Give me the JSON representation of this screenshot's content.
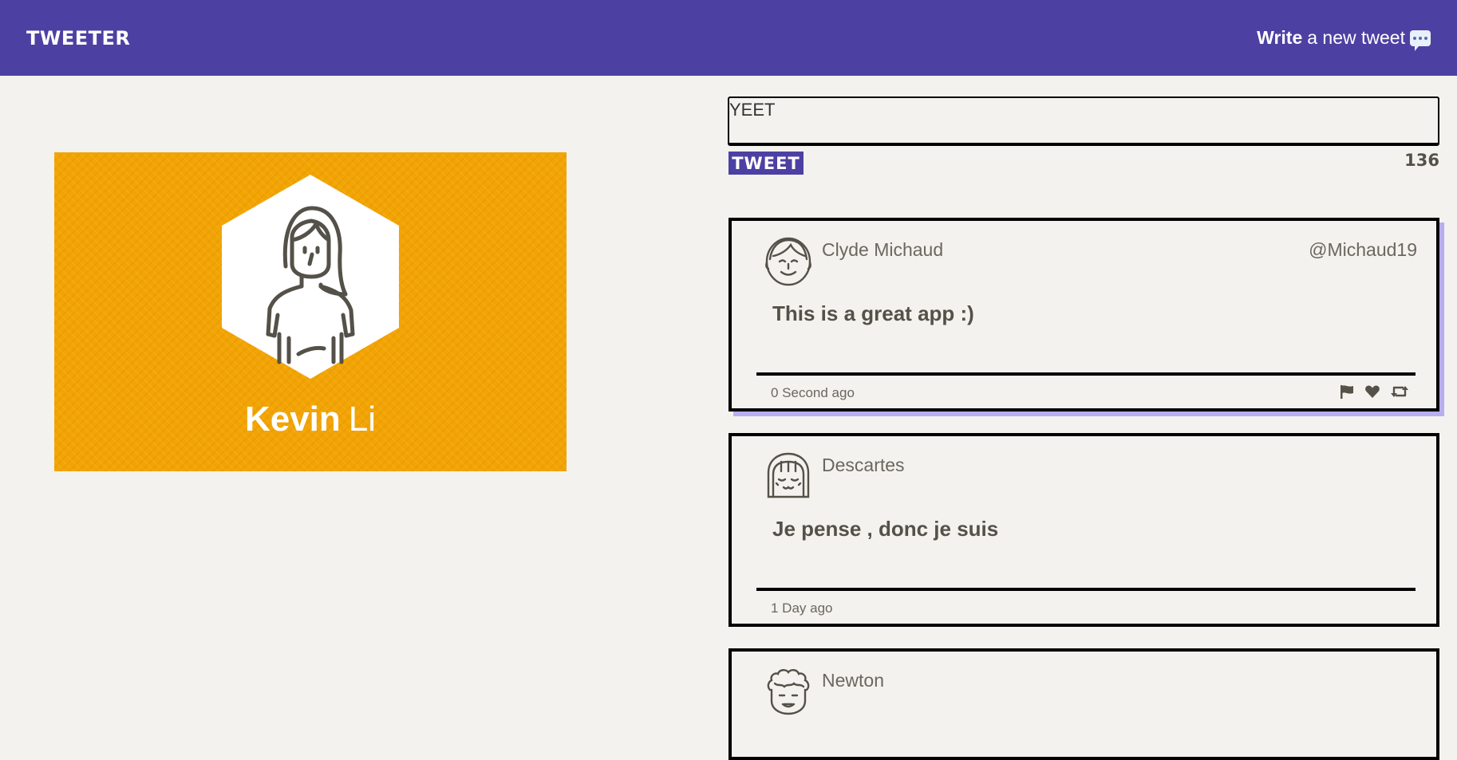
{
  "nav": {
    "logo": "TWEETER",
    "compose_bold": "Write",
    "compose_rest": "a new tweet",
    "compose_icon": "speech-bubble-icon"
  },
  "profile": {
    "first_name": "Kevin",
    "last_name": "Li",
    "background_color": "#f3a403",
    "avatar_icon": "woman-avatar-icon"
  },
  "composer": {
    "value": "YEET",
    "button_label": "TWEET",
    "remaining": "136"
  },
  "colors": {
    "primary": "#4c41a3",
    "background": "#f4f2ee",
    "highlight_shadow": "#b7aef0"
  },
  "tweets": [
    {
      "author": "Clyde Michaud",
      "handle": "@Michaud19",
      "content": "This is a great app :)",
      "time": "0 Second ago",
      "avatar_icon": "man-avatar-icon",
      "actions": [
        "flag-icon",
        "heart-icon",
        "retweet-icon"
      ]
    },
    {
      "author": "Descartes",
      "handle": "",
      "content": "Je pense , donc je suis",
      "time": "1 Day ago",
      "avatar_icon": "woman-bob-avatar-icon"
    },
    {
      "author": "Newton",
      "handle": "",
      "content": "",
      "time": "",
      "avatar_icon": "curly-hair-avatar-icon"
    }
  ]
}
